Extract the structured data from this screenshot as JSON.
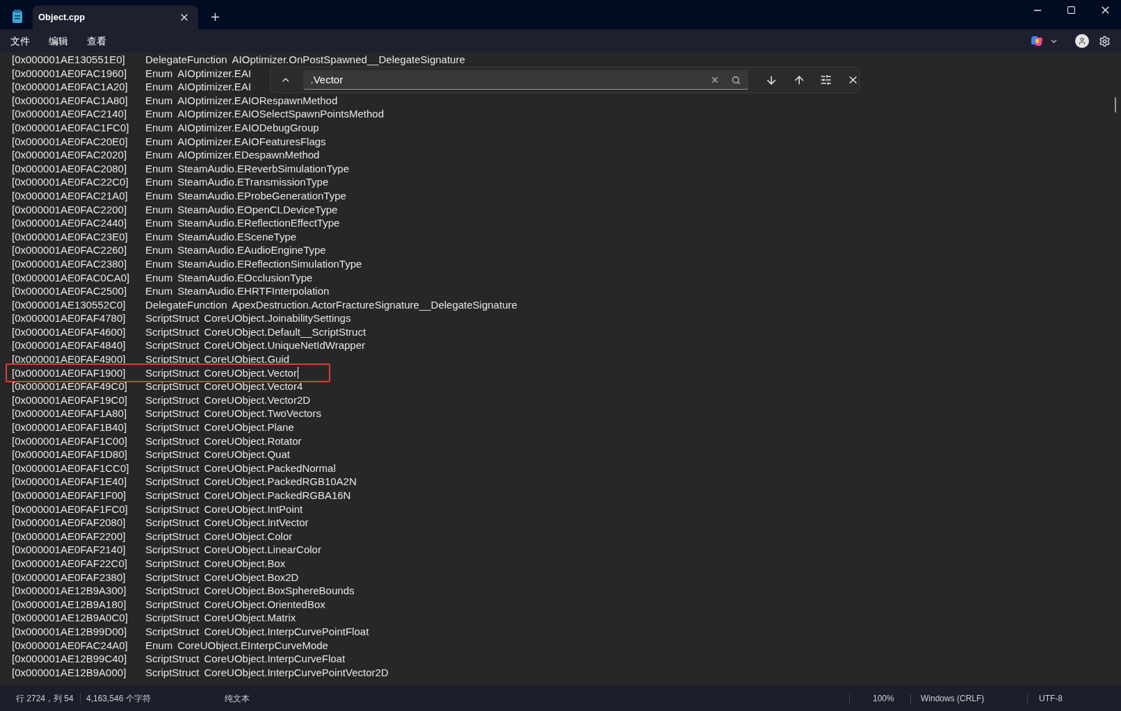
{
  "window": {
    "tab_title": "Object.cpp"
  },
  "menu": [
    "文件",
    "编辑",
    "查看"
  ],
  "find": {
    "value": ".Vector"
  },
  "lines": [
    {
      "address": "[0x000001AE130551E0]",
      "kind": "DelegateFunction",
      "name": "AIOptimizer.OnPostSpawned__DelegateSignature",
      "highlighted": false
    },
    {
      "address": "[0x000001AE0FAC1960]",
      "kind": "Enum",
      "name": "AIOptimizer.EAI",
      "highlighted": false
    },
    {
      "address": "[0x000001AE0FAC1A20]",
      "kind": "Enum",
      "name": "AIOptimizer.EAI",
      "highlighted": false
    },
    {
      "address": "[0x000001AE0FAC1A80]",
      "kind": "Enum",
      "name": "AIOptimizer.EAIORespawnMethod",
      "highlighted": false
    },
    {
      "address": "[0x000001AE0FAC2140]",
      "kind": "Enum",
      "name": "AIOptimizer.EAIOSelectSpawnPointsMethod",
      "highlighted": false
    },
    {
      "address": "[0x000001AE0FAC1FC0]",
      "kind": "Enum",
      "name": "AIOptimizer.EAIODebugGroup",
      "highlighted": false
    },
    {
      "address": "[0x000001AE0FAC20E0]",
      "kind": "Enum",
      "name": "AIOptimizer.EAIOFeaturesFlags",
      "highlighted": false
    },
    {
      "address": "[0x000001AE0FAC2020]",
      "kind": "Enum",
      "name": "AIOptimizer.EDespawnMethod",
      "highlighted": false
    },
    {
      "address": "[0x000001AE0FAC2080]",
      "kind": "Enum",
      "name": "SteamAudio.EReverbSimulationType",
      "highlighted": false
    },
    {
      "address": "[0x000001AE0FAC22C0]",
      "kind": "Enum",
      "name": "SteamAudio.ETransmissionType",
      "highlighted": false
    },
    {
      "address": "[0x000001AE0FAC21A0]",
      "kind": "Enum",
      "name": "SteamAudio.EProbeGenerationType",
      "highlighted": false
    },
    {
      "address": "[0x000001AE0FAC2200]",
      "kind": "Enum",
      "name": "SteamAudio.EOpenCLDeviceType",
      "highlighted": false
    },
    {
      "address": "[0x000001AE0FAC2440]",
      "kind": "Enum",
      "name": "SteamAudio.EReflectionEffectType",
      "highlighted": false
    },
    {
      "address": "[0x000001AE0FAC23E0]",
      "kind": "Enum",
      "name": "SteamAudio.ESceneType",
      "highlighted": false
    },
    {
      "address": "[0x000001AE0FAC2260]",
      "kind": "Enum",
      "name": "SteamAudio.EAudioEngineType",
      "highlighted": false
    },
    {
      "address": "[0x000001AE0FAC2380]",
      "kind": "Enum",
      "name": "SteamAudio.EReflectionSimulationType",
      "highlighted": false
    },
    {
      "address": "[0x000001AE0FAC0CA0]",
      "kind": "Enum",
      "name": "SteamAudio.EOcclusionType",
      "highlighted": false
    },
    {
      "address": "[0x000001AE0FAC2500]",
      "kind": "Enum",
      "name": "SteamAudio.EHRTFInterpolation",
      "highlighted": false
    },
    {
      "address": "[0x000001AE130552C0]",
      "kind": "DelegateFunction",
      "name": "ApexDestruction.ActorFractureSignature__DelegateSignature",
      "highlighted": false
    },
    {
      "address": "[0x000001AE0FAF4780]",
      "kind": "ScriptStruct",
      "name": "CoreUObject.JoinabilitySettings",
      "highlighted": false
    },
    {
      "address": "[0x000001AE0FAF4600]",
      "kind": "ScriptStruct",
      "name": "CoreUObject.Default__ScriptStruct",
      "highlighted": false
    },
    {
      "address": "[0x000001AE0FAF4840]",
      "kind": "ScriptStruct",
      "name": "CoreUObject.UniqueNetIdWrapper",
      "highlighted": false
    },
    {
      "address": "[0x000001AE0FAF4900]",
      "kind": "ScriptStruct",
      "name": "CoreUObject.Guid",
      "highlighted": false
    },
    {
      "address": "[0x000001AE0FAF1900]",
      "kind": "ScriptStruct",
      "name": "CoreUObject.Vector",
      "highlighted": true
    },
    {
      "address": "[0x000001AE0FAF49C0]",
      "kind": "ScriptStruct",
      "name": "CoreUObject.Vector4",
      "highlighted": false
    },
    {
      "address": "[0x000001AE0FAF19C0]",
      "kind": "ScriptStruct",
      "name": "CoreUObject.Vector2D",
      "highlighted": false
    },
    {
      "address": "[0x000001AE0FAF1A80]",
      "kind": "ScriptStruct",
      "name": "CoreUObject.TwoVectors",
      "highlighted": false
    },
    {
      "address": "[0x000001AE0FAF1B40]",
      "kind": "ScriptStruct",
      "name": "CoreUObject.Plane",
      "highlighted": false
    },
    {
      "address": "[0x000001AE0FAF1C00]",
      "kind": "ScriptStruct",
      "name": "CoreUObject.Rotator",
      "highlighted": false
    },
    {
      "address": "[0x000001AE0FAF1D80]",
      "kind": "ScriptStruct",
      "name": "CoreUObject.Quat",
      "highlighted": false
    },
    {
      "address": "[0x000001AE0FAF1CC0]",
      "kind": "ScriptStruct",
      "name": "CoreUObject.PackedNormal",
      "highlighted": false
    },
    {
      "address": "[0x000001AE0FAF1E40]",
      "kind": "ScriptStruct",
      "name": "CoreUObject.PackedRGB10A2N",
      "highlighted": false
    },
    {
      "address": "[0x000001AE0FAF1F00]",
      "kind": "ScriptStruct",
      "name": "CoreUObject.PackedRGBA16N",
      "highlighted": false
    },
    {
      "address": "[0x000001AE0FAF1FC0]",
      "kind": "ScriptStruct",
      "name": "CoreUObject.IntPoint",
      "highlighted": false
    },
    {
      "address": "[0x000001AE0FAF2080]",
      "kind": "ScriptStruct",
      "name": "CoreUObject.IntVector",
      "highlighted": false
    },
    {
      "address": "[0x000001AE0FAF2200]",
      "kind": "ScriptStruct",
      "name": "CoreUObject.Color",
      "highlighted": false
    },
    {
      "address": "[0x000001AE0FAF2140]",
      "kind": "ScriptStruct",
      "name": "CoreUObject.LinearColor",
      "highlighted": false
    },
    {
      "address": "[0x000001AE0FAF22C0]",
      "kind": "ScriptStruct",
      "name": "CoreUObject.Box",
      "highlighted": false
    },
    {
      "address": "[0x000001AE0FAF2380]",
      "kind": "ScriptStruct",
      "name": "CoreUObject.Box2D",
      "highlighted": false
    },
    {
      "address": "[0x000001AE12B9A300]",
      "kind": "ScriptStruct",
      "name": "CoreUObject.BoxSphereBounds",
      "highlighted": false
    },
    {
      "address": "[0x000001AE12B9A180]",
      "kind": "ScriptStruct",
      "name": "CoreUObject.OrientedBox",
      "highlighted": false
    },
    {
      "address": "[0x000001AE12B9A0C0]",
      "kind": "ScriptStruct",
      "name": "CoreUObject.Matrix",
      "highlighted": false
    },
    {
      "address": "[0x000001AE12B99D00]",
      "kind": "ScriptStruct",
      "name": "CoreUObject.InterpCurvePointFloat",
      "highlighted": false
    },
    {
      "address": "[0x000001AE0FAC24A0]",
      "kind": "Enum",
      "name": "CoreUObject.EInterpCurveMode",
      "highlighted": false
    },
    {
      "address": "[0x000001AE12B99C40]",
      "kind": "ScriptStruct",
      "name": "CoreUObject.InterpCurveFloat",
      "highlighted": false
    },
    {
      "address": "[0x000001AE12B9A000]",
      "kind": "ScriptStruct",
      "name": "CoreUObject.InterpCurvePointVector2D",
      "highlighted": false
    }
  ],
  "status_bar": {
    "position": "行 2724，列 54",
    "characters": "4,163,546 个字符",
    "format": "纯文本",
    "zoom": "100%",
    "line_ending": "Windows (CRLF)",
    "encoding": "UTF-8"
  }
}
